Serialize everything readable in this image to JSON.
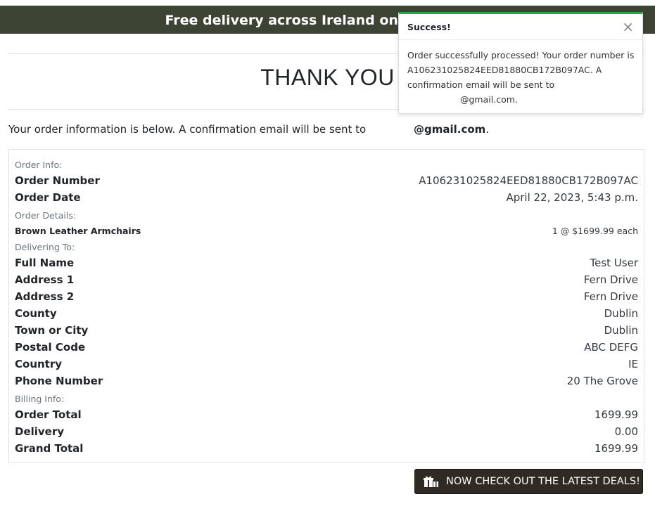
{
  "banner": {
    "text": "Free delivery across Ireland on orders over"
  },
  "page": {
    "title": "THANK YOU",
    "intro_text": "Your order information is below. A confirmation email will be sent to",
    "intro_email": "@gmail.com",
    "intro_period": "."
  },
  "order": {
    "sections": {
      "info": "Order Info:",
      "details": "Order Details:",
      "delivering": "Delivering To:",
      "billing": "Billing Info:"
    },
    "order_number_label": "Order Number",
    "order_number": "A106231025824EED81880CB172B097AC",
    "order_date_label": "Order Date",
    "order_date": "April 22, 2023, 5:43 p.m.",
    "item_name": "Brown Leather Armchairs",
    "item_qty_price": "1 @ $1699.99 each",
    "delivery": [
      {
        "label": "Full Name",
        "value": "Test User"
      },
      {
        "label": "Address 1",
        "value": "Fern Drive"
      },
      {
        "label": "Address 2",
        "value": "Fern Drive"
      },
      {
        "label": "County",
        "value": "Dublin"
      },
      {
        "label": "Town or City",
        "value": "Dublin"
      },
      {
        "label": "Postal Code",
        "value": "ABC DEFG"
      },
      {
        "label": "Country",
        "value": "IE"
      },
      {
        "label": "Phone Number",
        "value": "20 The Grove"
      }
    ],
    "billing": [
      {
        "label": "Order Total",
        "value": "1699.99"
      },
      {
        "label": "Delivery",
        "value": "0.00"
      },
      {
        "label": "Grand Total",
        "value": "1699.99"
      }
    ]
  },
  "cta": {
    "label": "NOW CHECK OUT THE LATEST DEALS!",
    "icon": "gift-icon"
  },
  "toast": {
    "title": "Success!",
    "close": "×",
    "line1": "Order successfully processed! Your order number is A106231025824EED81880CB172B097AC. A confirmation email will be sent to",
    "line2": "@gmail.com.",
    "accent_color": "#28a745"
  },
  "colors": {
    "banner_bg": "#3d4433",
    "button_bg": "#2f2a24"
  }
}
